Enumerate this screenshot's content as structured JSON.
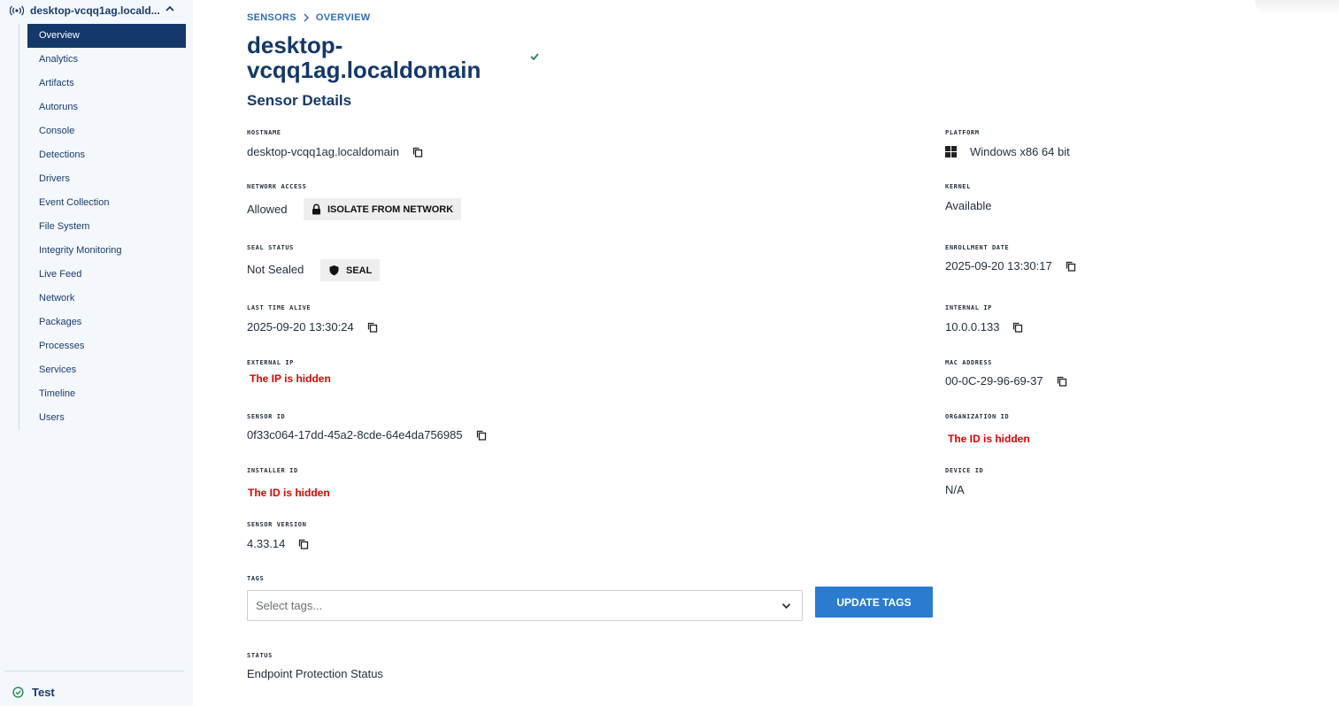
{
  "sidebar": {
    "sensor_name": "desktop-vcqq1ag.locald...",
    "items": [
      {
        "label": "Overview"
      },
      {
        "label": "Analytics"
      },
      {
        "label": "Artifacts"
      },
      {
        "label": "Autoruns"
      },
      {
        "label": "Console"
      },
      {
        "label": "Detections"
      },
      {
        "label": "Drivers"
      },
      {
        "label": "Event Collection"
      },
      {
        "label": "File System"
      },
      {
        "label": "Integrity Monitoring"
      },
      {
        "label": "Live Feed"
      },
      {
        "label": "Network"
      },
      {
        "label": "Packages"
      },
      {
        "label": "Processes"
      },
      {
        "label": "Services"
      },
      {
        "label": "Timeline"
      },
      {
        "label": "Users"
      }
    ],
    "active_index": 0,
    "org_name": "Test"
  },
  "breadcrumb": {
    "sensors": "SENSORS",
    "overview": "OVERVIEW"
  },
  "page_title": "desktop-vcqq1ag.localdomain",
  "section_title": "Sensor Details",
  "fields": {
    "hostname": {
      "label": "HOSTNAME",
      "value": "desktop-vcqq1ag.localdomain"
    },
    "network_access": {
      "label": "NETWORK ACCESS",
      "value": "Allowed",
      "action": "ISOLATE FROM NETWORK"
    },
    "seal_status": {
      "label": "SEAL STATUS",
      "value": "Not Sealed",
      "action": "SEAL"
    },
    "last_time_alive": {
      "label": "LAST TIME ALIVE",
      "value": "2025-09-20 13:30:24"
    },
    "external_ip": {
      "label": "EXTERNAL IP",
      "value": "The IP is hidden"
    },
    "sensor_id": {
      "label": "SENSOR ID",
      "value": "0f33c064-17dd-45a2-8cde-64e4da756985"
    },
    "installer_id": {
      "label": "INSTALLER ID",
      "value": "The ID is hidden"
    },
    "sensor_version": {
      "label": "SENSOR VERSION",
      "value": "4.33.14"
    },
    "platform": {
      "label": "PLATFORM",
      "value": "Windows x86 64 bit"
    },
    "kernel": {
      "label": "KERNEL",
      "value": "Available"
    },
    "enrollment_date": {
      "label": "ENROLLMENT DATE",
      "value": "2025-09-20 13:30:17"
    },
    "internal_ip": {
      "label": "INTERNAL IP",
      "value": "10.0.0.133"
    },
    "mac_address": {
      "label": "MAC ADDRESS",
      "value": "00-0C-29-96-69-37"
    },
    "organization_id": {
      "label": "ORGANIZATION ID",
      "value": "The ID is hidden"
    },
    "device_id": {
      "label": "DEVICE ID",
      "value": "N/A"
    },
    "tags": {
      "label": "TAGS",
      "placeholder": "Select tags...",
      "button": "UPDATE TAGS"
    },
    "status": {
      "label": "STATUS",
      "value": "Endpoint Protection Status"
    }
  },
  "colors": {
    "primary_dark": "#14386a",
    "link_blue": "#2f6db8",
    "button_blue": "#2b7bd1",
    "hidden_red": "#e00000",
    "success_green": "#1f8a4c"
  }
}
